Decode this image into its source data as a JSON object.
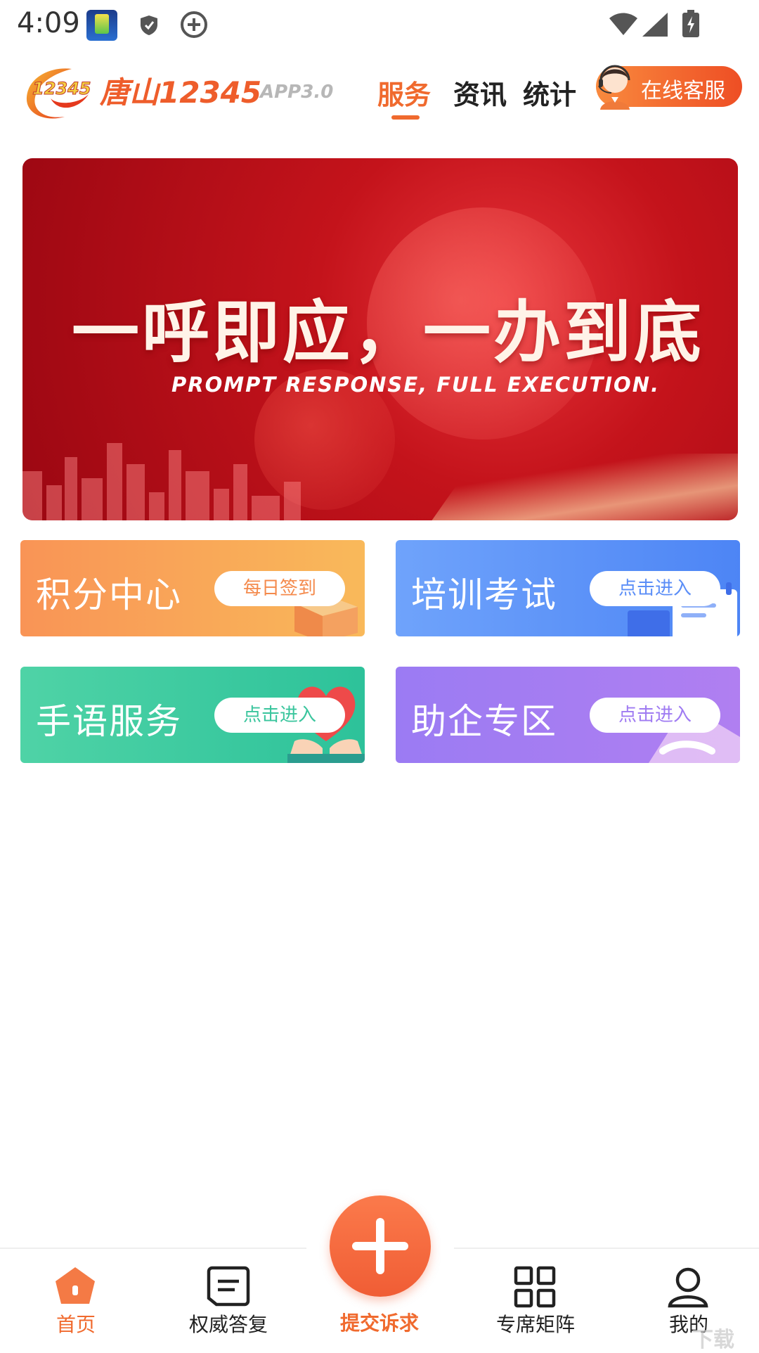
{
  "status_bar": {
    "time": "4:09"
  },
  "header": {
    "logo_badge": "12345",
    "logo_text": "唐山12345",
    "logo_version": "APP3.0",
    "tabs": [
      {
        "label": "服务",
        "active": true
      },
      {
        "label": "资讯",
        "active": false
      },
      {
        "label": "统计",
        "active": false
      }
    ],
    "customer_service_label": "在线客服",
    "accent_color": "#f06a2e"
  },
  "banner": {
    "title": "一呼即应，一办到底",
    "subtitle": "PROMPT RESPONSE, FULL EXECUTION."
  },
  "cards": [
    {
      "title": "积分中心",
      "button": "每日签到",
      "color": "#f9a157"
    },
    {
      "title": "培训考试",
      "button": "点击进入",
      "color": "#5b8ef7"
    },
    {
      "title": "手语服务",
      "button": "点击进入",
      "color": "#3ac59d"
    },
    {
      "title": "助企专区",
      "button": "点击进入",
      "color": "#a27cf2"
    }
  ],
  "bottom_nav": [
    {
      "label": "首页",
      "icon": "home-icon",
      "active": true
    },
    {
      "label": "权威答复",
      "icon": "message-icon",
      "active": false
    },
    {
      "label": "提交诉求",
      "icon": "plus-icon",
      "active": false
    },
    {
      "label": "专席矩阵",
      "icon": "grid-icon",
      "active": false
    },
    {
      "label": "我的",
      "icon": "user-icon",
      "active": false
    }
  ],
  "watermark": "下载"
}
